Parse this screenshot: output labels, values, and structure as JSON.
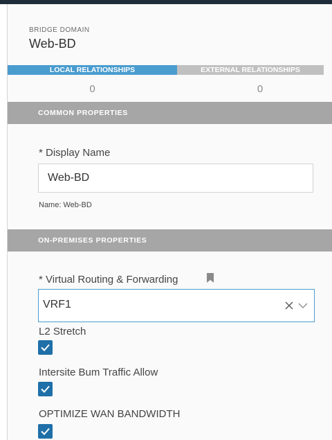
{
  "header": {
    "type_label": "BRIDGE DOMAIN",
    "name": "Web-BD"
  },
  "tabs": [
    {
      "label": "LOCAL RELATIONSHIPS",
      "count": "0",
      "active": true
    },
    {
      "label": "EXTERNAL RELATIONSHIPS",
      "count": "0",
      "active": false
    }
  ],
  "sections": {
    "common": "COMMON PROPERTIES",
    "onprem": "ON-PREMISES PROPERTIES"
  },
  "display_name": {
    "label": "* Display Name",
    "value": "Web-BD",
    "hint": "Name: Web-BD"
  },
  "vrf": {
    "label": "* Virtual Routing & Forwarding",
    "value": "VRF1",
    "icons": [
      "bookmark-icon",
      "clear-icon",
      "chevron-down-icon"
    ]
  },
  "checkboxes": [
    {
      "label": "L2 Stretch",
      "checked": true
    },
    {
      "label": "Intersite Bum Traffic Allow",
      "checked": true
    },
    {
      "label": "OPTIMIZE WAN BANDWIDTH",
      "checked": true
    }
  ],
  "colors": {
    "active_tab": "#4a9ccf",
    "inactive_tab": "#c0c0c0",
    "section_bar": "#a6a6a6",
    "checkbox": "#1f6fa8",
    "top_bar": "#1f2c3a"
  }
}
